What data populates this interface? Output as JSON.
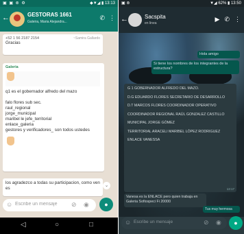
{
  "left": {
    "status": {
      "icons": "▣ ▣ ⊚ ⚙",
      "right": "◆▼◢ ▮ 13:13"
    },
    "header": {
      "title": "GESTORAS 1661",
      "subtitle": "Galeira, Maria Alejandra..."
    },
    "messages": [
      {
        "phone": "+52 1 56 2187 2154",
        "handle": "~Samira Gallardo",
        "text": "Gracias"
      },
      {
        "sender": "Galeria",
        "text": "q1 es el gobernador alfredo del mazo\n\nfalo flores sub sec.\nraul_regional\njorge_municipal\nmaribel le jefe_territorial\nenlace_galeria\ngestores y verificadores_ son todos ustedes"
      },
      {
        "text": "los agradezco a todas su participacion, como ven es"
      }
    ],
    "input_placeholder": "Escribe un mensaje",
    "nav": {
      "back": "◁",
      "home": "○",
      "recent": "□"
    }
  },
  "right": {
    "status": {
      "left": "▣ ⊚",
      "right": "▼◢ 62% ▮ 13:50"
    },
    "header": {
      "title": "Sacspita",
      "subtitle": "en linea"
    },
    "out1": "Hola amigo",
    "out2": "Si tiene los nombres de los integrantes de la estructura?",
    "lines": [
      "G 1 Gobernador Alfredo del Mazo.",
      "D.G EDUARDO FLORES SECRETARIO DE DESARROLLO",
      "D.T MARCOS FLORES COORDINADOR OPERATIVO",
      "COORDINADOR REGIONAL RAÚL GONZALEZ CASTILLO",
      "MUNICIPAL JORGE GÓMEZ",
      "TERRITORIAL ARACELI MARIBEL LÓPEZ RODRIGUEZ",
      "ENLACE VANESSA"
    ],
    "in_meta": "13:17",
    "in2": "Vanesa es la ENLACE pero quien trabaja en Galeria Sofiospeci Fi 20000",
    "out3": "Tus muy hermosa",
    "input_placeholder": "Escribe un mensaje"
  }
}
